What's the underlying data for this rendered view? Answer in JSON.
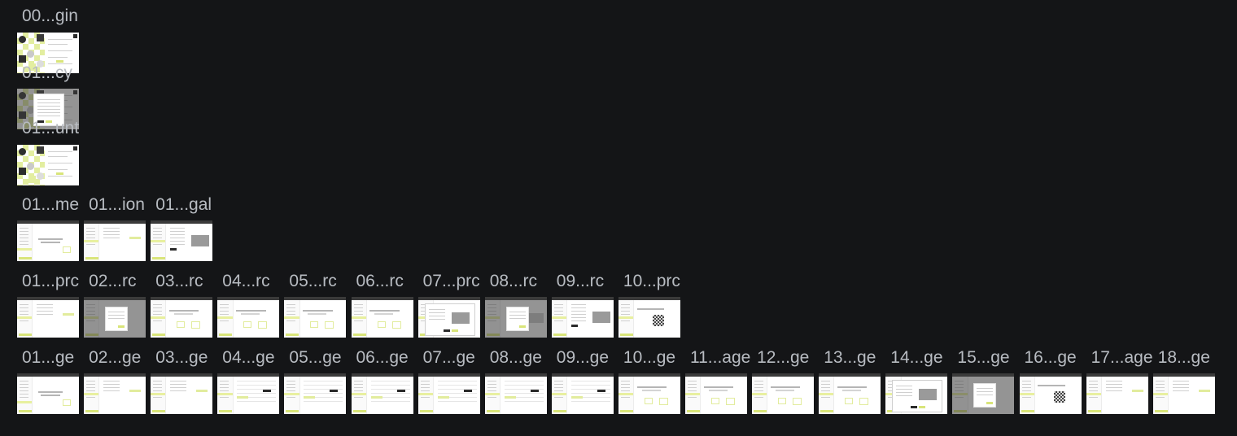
{
  "rows": [
    {
      "id": "row1",
      "items": [
        {
          "label": "00...gin",
          "kind": "login"
        }
      ]
    },
    {
      "id": "row2",
      "items": [
        {
          "label": "01...cy",
          "kind": "login-modal"
        }
      ]
    },
    {
      "id": "row3",
      "items": [
        {
          "label": "01...unt",
          "kind": "login"
        }
      ]
    },
    {
      "id": "row4",
      "items": [
        {
          "label": "01...me",
          "kind": "app"
        },
        {
          "label": "01...ion",
          "kind": "app-form"
        },
        {
          "label": "01...gal",
          "kind": "app-photo"
        }
      ]
    },
    {
      "id": "row5",
      "items": [
        {
          "label": "01...prc",
          "kind": "app-form"
        },
        {
          "label": "02...rc",
          "kind": "app-modal"
        },
        {
          "label": "03...rc",
          "kind": "app-center"
        },
        {
          "label": "04...rc",
          "kind": "app-center"
        },
        {
          "label": "05...rc",
          "kind": "app-center"
        },
        {
          "label": "06...rc",
          "kind": "app-center"
        },
        {
          "label": "07...prc",
          "kind": "app-dialog"
        },
        {
          "label": "08...rc",
          "kind": "app-modal-photo"
        },
        {
          "label": "09...rc",
          "kind": "app-photo"
        },
        {
          "label": "10...prc",
          "kind": "app-qr"
        }
      ]
    },
    {
      "id": "row6",
      "items": [
        {
          "label": "01...ge",
          "kind": "app"
        },
        {
          "label": "02...ge",
          "kind": "app-form"
        },
        {
          "label": "03...ge",
          "kind": "app-form"
        },
        {
          "label": "04...ge",
          "kind": "app-table"
        },
        {
          "label": "05...ge",
          "kind": "app-table"
        },
        {
          "label": "06...ge",
          "kind": "app-table"
        },
        {
          "label": "07...ge",
          "kind": "app-table"
        },
        {
          "label": "08...ge",
          "kind": "app-table"
        },
        {
          "label": "09...ge",
          "kind": "app-table"
        },
        {
          "label": "10...ge",
          "kind": "app-center"
        },
        {
          "label": "11...age",
          "kind": "app-center"
        },
        {
          "label": "12...ge",
          "kind": "app-center"
        },
        {
          "label": "13...ge",
          "kind": "app-center"
        },
        {
          "label": "14...ge",
          "kind": "app-dialog"
        },
        {
          "label": "15...ge",
          "kind": "app-modal"
        },
        {
          "label": "16...ge",
          "kind": "app-qr"
        },
        {
          "label": "17...age",
          "kind": "app-form"
        },
        {
          "label": "18...ge",
          "kind": "app-form"
        }
      ]
    }
  ],
  "colors": {
    "background": "#141517",
    "label": "#b8bcc2",
    "accent": "#e2ec9d",
    "thumb": "#ffffff"
  }
}
